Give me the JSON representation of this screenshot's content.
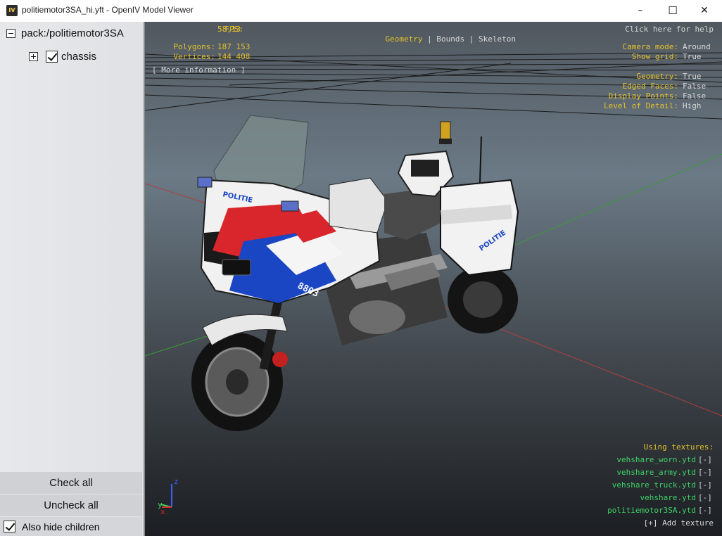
{
  "window": {
    "title": "politiemotor3SA_hi.yft - OpenIV Model Viewer",
    "icon_text": "IV",
    "controls": {
      "minimize": "–",
      "maximize": "☐",
      "close": "✕"
    }
  },
  "tree": {
    "root": "pack:/politiemotor3SA",
    "child": "chassis"
  },
  "buttons": {
    "check_all": "Check all",
    "uncheck_all": "Uncheck all",
    "also_hide_children": "Also hide children"
  },
  "osd": {
    "fps_label": "FPS:",
    "fps": "58,13",
    "polygons_label": "Polygons:",
    "polygons": "187 153",
    "vertices_label": "Vertices:",
    "vertices": "144 408",
    "more_info": "[ More information ]",
    "tabs": {
      "geometry": "Geometry",
      "sep": "|",
      "bounds": "Bounds",
      "skeleton": "Skeleton"
    },
    "help": "Click here for help",
    "camera_label": "Camera mode:",
    "camera": "Around",
    "grid_label": "Show grid:",
    "grid": "True",
    "geometry_label": "Geometry:",
    "geometry": "True",
    "edged_label": "Edged Faces:",
    "edged": "False",
    "points_label": "Display Points:",
    "points": "False",
    "lod_label": "Level of Detail:",
    "lod": "High"
  },
  "textures": {
    "heading": "Using textures:",
    "remove": "[-]",
    "items": [
      "vehshare_worn.ytd",
      "vehshare_army.ytd",
      "vehshare_truck.ytd",
      "vehshare.ytd",
      "politiemotor3SA.ytd"
    ],
    "add": "[+] Add texture"
  },
  "axes": {
    "z": "z",
    "y": "y",
    "x": "x"
  },
  "model": {
    "front_text": "POLITIE",
    "case_text": "POLITIE",
    "number": "8803"
  },
  "colors": {
    "osd_yellow": "#e3c22c",
    "texture_green": "#3fd267",
    "grid": "#1c1c1c",
    "accent_red": "#d8262c",
    "accent_blue": "#1a46c4"
  }
}
